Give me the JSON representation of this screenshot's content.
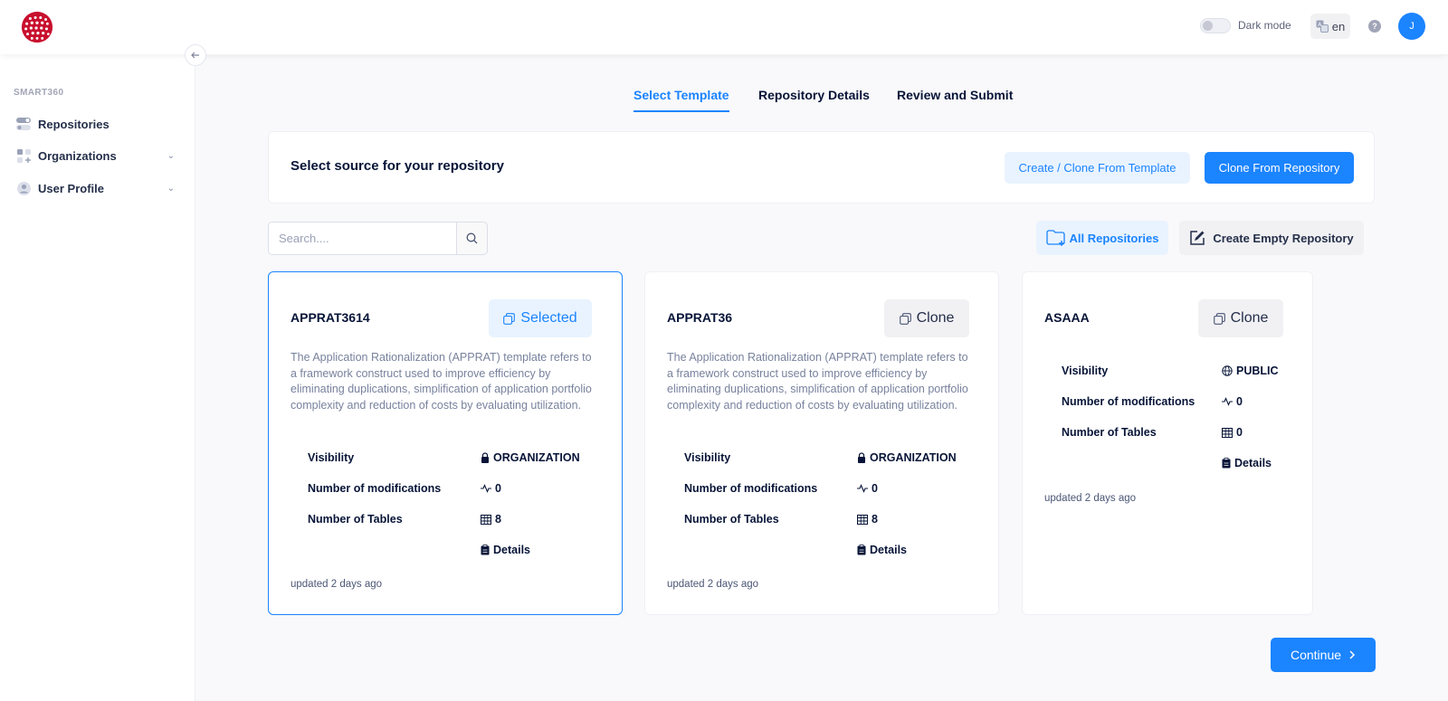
{
  "header": {
    "dark_mode_label": "Dark mode",
    "language": "en",
    "avatar_initial": "J"
  },
  "sidebar": {
    "section_title": "SMART360",
    "items": [
      {
        "label": "Repositories",
        "icon": "toggle-icon"
      },
      {
        "label": "Organizations",
        "icon": "grid-icon"
      },
      {
        "label": "User Profile",
        "icon": "user-icon"
      }
    ]
  },
  "tabs": [
    {
      "label": "Select Template",
      "active": true
    },
    {
      "label": "Repository Details"
    },
    {
      "label": "Review and Submit"
    }
  ],
  "source": {
    "title": "Select source for your repository",
    "template_button": "Create / Clone From Template",
    "repo_button": "Clone From Repository"
  },
  "search": {
    "placeholder": "Search...."
  },
  "actions": {
    "all_repositories": "All Repositories",
    "create_empty": "Create Empty Repository"
  },
  "labels": {
    "visibility": "Visibility",
    "modifications": "Number of modifications",
    "tables": "Number of Tables",
    "details": "Details"
  },
  "repos": [
    {
      "name": "APPRAT3614",
      "button": "Selected",
      "description": "The Application Rationalization (APPRAT) template refers to a framework construct used to improve efficiency by eliminating duplications, simplification of application portfolio complexity and reduction of costs by evaluating utilization.",
      "visibility": "ORGANIZATION",
      "modifications": "0",
      "tables": "8",
      "updated": "updated 2 days ago"
    },
    {
      "name": "APPRAT36",
      "button": "Clone",
      "description": "The Application Rationalization (APPRAT) template refers to a framework construct used to improve efficiency by eliminating duplications, simplification of application portfolio complexity and reduction of costs by evaluating utilization.",
      "visibility": "ORGANIZATION",
      "modifications": "0",
      "tables": "8",
      "updated": "updated 2 days ago"
    },
    {
      "name": "ASAAA",
      "button": "Clone",
      "description": "",
      "visibility": "PUBLIC",
      "modifications": "0",
      "tables": "0",
      "updated": "updated 2 days ago"
    }
  ],
  "continue_label": "Continue",
  "colors": {
    "primary": "#1b84ff",
    "primary_light": "#e9f3ff",
    "text_dark": "#071437",
    "text_muted": "#78829d"
  }
}
